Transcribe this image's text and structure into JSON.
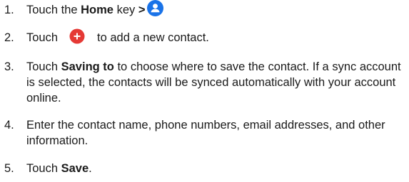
{
  "steps": [
    {
      "number": "1.",
      "pre": "Touch the ",
      "bold": "Home",
      "post": " key ",
      "arrow": ">",
      "icon": "contacts-app-icon",
      "icon_color": "#1a73e8"
    },
    {
      "number": "2.",
      "pre": "Touch",
      "icon": "add-contact-plus-icon",
      "icon_color": "#e53935",
      "post": "to add a new contact."
    },
    {
      "number": "3.",
      "pre": "Touch ",
      "bold": "Saving to",
      "post": " to choose where to save the contact. If a sync account is selected, the contacts will be synced automatically with your account online."
    },
    {
      "number": "4.",
      "text": "Enter the contact name, phone numbers, email addresses, and other information."
    },
    {
      "number": "5.",
      "pre": "Touch ",
      "bold": "Save",
      "post": "."
    }
  ]
}
